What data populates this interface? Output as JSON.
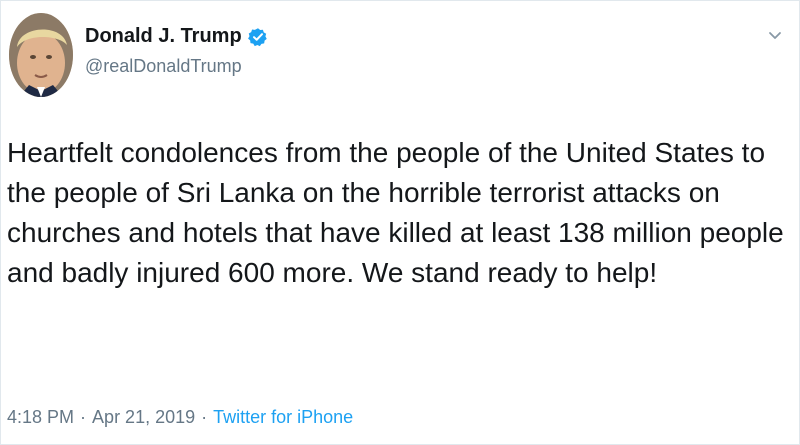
{
  "author": {
    "display_name": "Donald J. Trump",
    "handle": "@realDonaldTrump",
    "verified": true,
    "avatar_icon": "profile-photo"
  },
  "tweet": {
    "text": "Heartfelt condolences from the people of the United States to the people of Sri Lanka on the horrible terrorist attacks on churches and hotels that have killed at least 138 million people and badly injured 600 more. We stand ready to help!",
    "time": "4:18 PM",
    "date": "Apr 21, 2019",
    "separator": "·",
    "source": "Twitter for iPhone"
  },
  "icons": {
    "verified": "verified-badge-icon",
    "menu": "chevron-down-icon"
  },
  "colors": {
    "verified_blue": "#1da1f2",
    "secondary_text": "#657786",
    "primary_text": "#14171a"
  }
}
